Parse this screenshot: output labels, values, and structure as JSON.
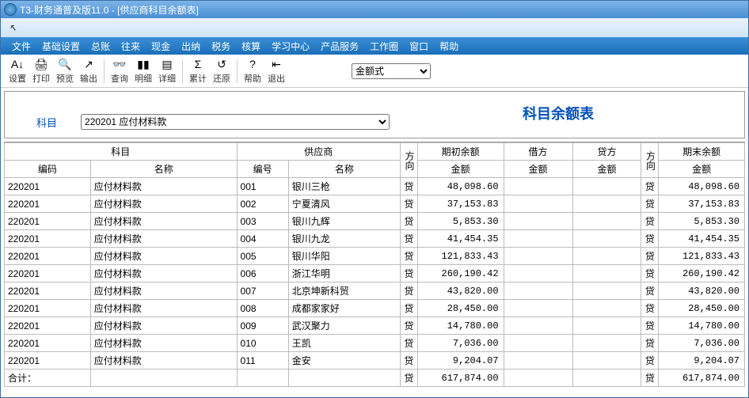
{
  "window": {
    "title": "T3-财务通普及版11.0 - [供应商科目余额表]"
  },
  "menu": {
    "items": [
      "文件",
      "基础设置",
      "总账",
      "往来",
      "现金",
      "出纳",
      "税务",
      "核算",
      "学习中心",
      "产品服务",
      "工作圈",
      "窗口",
      "帮助"
    ]
  },
  "toolbar": {
    "items": [
      {
        "label": "设置",
        "icon": "A↓"
      },
      {
        "label": "打印",
        "icon": "🖨"
      },
      {
        "label": "预览",
        "icon": "🔍"
      },
      {
        "label": "输出",
        "icon": "↗"
      }
    ],
    "items2": [
      {
        "label": "查询",
        "icon": "👓"
      },
      {
        "label": "明细",
        "icon": "▮▮"
      },
      {
        "label": "详细",
        "icon": "▤"
      }
    ],
    "items3": [
      {
        "label": "累计",
        "icon": "Σ"
      },
      {
        "label": "还原",
        "icon": "↺"
      }
    ],
    "items4": [
      {
        "label": "帮助",
        "icon": "?"
      },
      {
        "label": "退出",
        "icon": "⇤"
      }
    ],
    "amount_mode": "金额式"
  },
  "header": {
    "report_title": "科目余额表",
    "subject_label": "科目",
    "subject_value": "220201 应付材料款"
  },
  "grid": {
    "group_headers": {
      "subject": "科目",
      "vendor": "供应商",
      "dir1": "方向",
      "open": "期初余额",
      "debit": "借方",
      "credit": "贷方",
      "dir2": "方向",
      "close": "期末余额"
    },
    "sub_headers": {
      "code": "编码",
      "name": "名称",
      "vcode": "编号",
      "vname": "名称",
      "amt": "金额"
    },
    "rows": [
      {
        "code": "220201",
        "name": "应付材料款",
        "vcode": "001",
        "vname": "银川三枪",
        "dir1": "贷",
        "open": "48,098.60",
        "debit": "",
        "credit": "",
        "dir2": "贷",
        "close": "48,098.60"
      },
      {
        "code": "220201",
        "name": "应付材料款",
        "vcode": "002",
        "vname": "宁夏清风",
        "dir1": "贷",
        "open": "37,153.83",
        "debit": "",
        "credit": "",
        "dir2": "贷",
        "close": "37,153.83"
      },
      {
        "code": "220201",
        "name": "应付材料款",
        "vcode": "003",
        "vname": "银川九辉",
        "dir1": "贷",
        "open": "5,853.30",
        "debit": "",
        "credit": "",
        "dir2": "贷",
        "close": "5,853.30"
      },
      {
        "code": "220201",
        "name": "应付材料款",
        "vcode": "004",
        "vname": "银川九龙",
        "dir1": "贷",
        "open": "41,454.35",
        "debit": "",
        "credit": "",
        "dir2": "贷",
        "close": "41,454.35"
      },
      {
        "code": "220201",
        "name": "应付材料款",
        "vcode": "005",
        "vname": "银川华阳",
        "dir1": "贷",
        "open": "121,833.43",
        "debit": "",
        "credit": "",
        "dir2": "贷",
        "close": "121,833.43"
      },
      {
        "code": "220201",
        "name": "应付材料款",
        "vcode": "006",
        "vname": "浙江华明",
        "dir1": "贷",
        "open": "260,190.42",
        "debit": "",
        "credit": "",
        "dir2": "贷",
        "close": "260,190.42"
      },
      {
        "code": "220201",
        "name": "应付材料款",
        "vcode": "007",
        "vname": "北京坤新科贸",
        "dir1": "贷",
        "open": "43,820.00",
        "debit": "",
        "credit": "",
        "dir2": "贷",
        "close": "43,820.00"
      },
      {
        "code": "220201",
        "name": "应付材料款",
        "vcode": "008",
        "vname": "成都家家好",
        "dir1": "贷",
        "open": "28,450.00",
        "debit": "",
        "credit": "",
        "dir2": "贷",
        "close": "28,450.00"
      },
      {
        "code": "220201",
        "name": "应付材料款",
        "vcode": "009",
        "vname": "武汉聚力",
        "dir1": "贷",
        "open": "14,780.00",
        "debit": "",
        "credit": "",
        "dir2": "贷",
        "close": "14,780.00"
      },
      {
        "code": "220201",
        "name": "应付材料款",
        "vcode": "010",
        "vname": "王凯",
        "dir1": "贷",
        "open": "7,036.00",
        "debit": "",
        "credit": "",
        "dir2": "贷",
        "close": "7,036.00"
      },
      {
        "code": "220201",
        "name": "应付材料款",
        "vcode": "011",
        "vname": "金安",
        "dir1": "贷",
        "open": "9,204.07",
        "debit": "",
        "credit": "",
        "dir2": "贷",
        "close": "9,204.07"
      }
    ],
    "total": {
      "code": "合计：",
      "name": "",
      "vcode": "",
      "vname": "",
      "dir1": "贷",
      "open": "617,874.00",
      "debit": "",
      "credit": "",
      "dir2": "贷",
      "close": "617,874.00"
    }
  }
}
